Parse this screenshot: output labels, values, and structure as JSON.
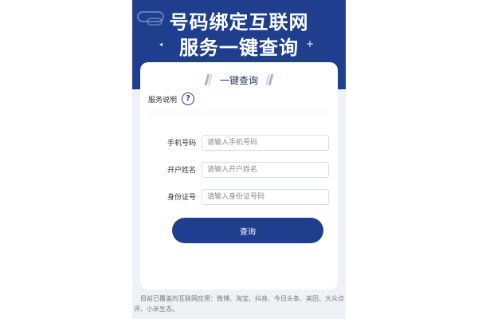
{
  "banner": {
    "title_line1": "号码绑定互联网",
    "title_line2": "服务一键查询"
  },
  "card": {
    "title": "一键查询",
    "service_label": "服务说明",
    "help_symbol": "?"
  },
  "form": {
    "phone": {
      "label": "手机号码",
      "placeholder": "请输入手机号码"
    },
    "name": {
      "label": "开户姓名",
      "placeholder": "请输入开户姓名"
    },
    "id_number": {
      "label": "身份证号",
      "placeholder": "请输入身份证号码"
    },
    "submit_label": "查询"
  },
  "footer": {
    "note": "目前已覆盖的互联网应用：微博、淘宝、抖音、今日头条、美团、大众点评、小米生态。"
  },
  "colors": {
    "primary": "#1f3f8e",
    "background": "#eef1f6",
    "card": "#ffffff"
  }
}
